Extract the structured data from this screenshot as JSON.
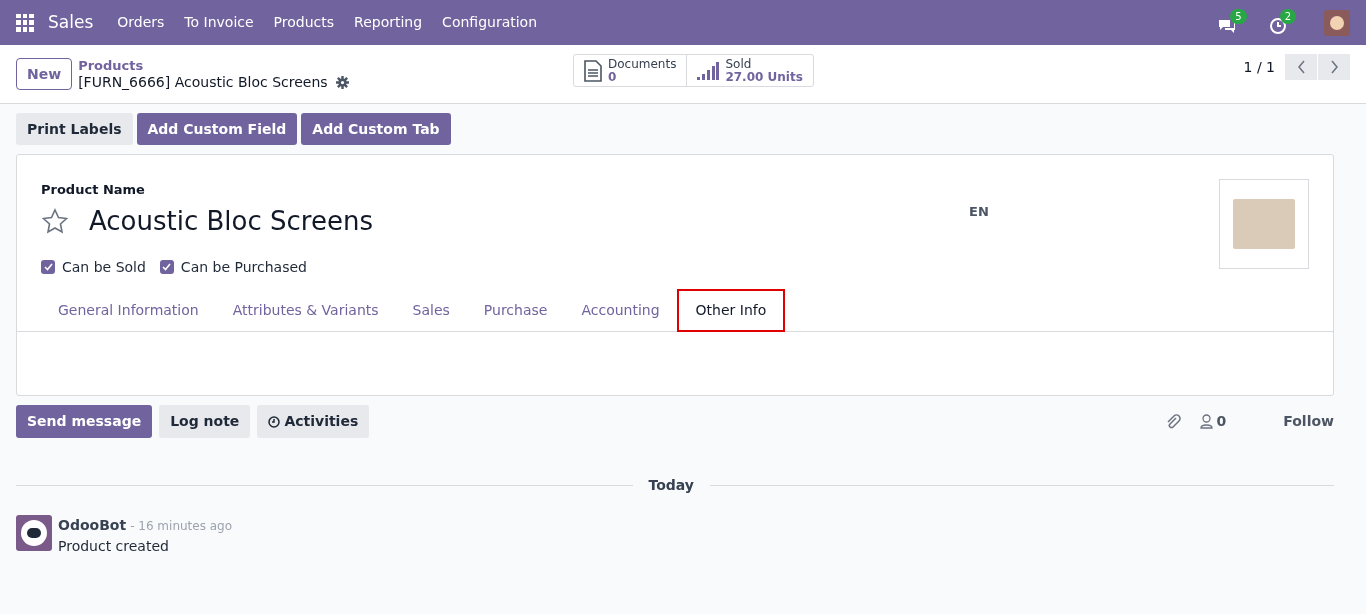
{
  "navbar": {
    "app": "Sales",
    "menu": [
      "Orders",
      "To Invoice",
      "Products",
      "Reporting",
      "Configuration"
    ],
    "messages_count": "5",
    "activities_count": "2"
  },
  "control_panel": {
    "new_button": "New",
    "breadcrumb": "Products",
    "record": "[FURN_6666] Acoustic Bloc Screens",
    "smart_buttons": [
      {
        "kind": "documents",
        "label": "Documents",
        "value": "0"
      },
      {
        "kind": "sold",
        "label": "Sold",
        "value": "27.00 Units"
      }
    ],
    "pager": "1 / 1"
  },
  "actions": [
    {
      "label": "Print Labels",
      "kind": "secondary"
    },
    {
      "label": "Add Custom Field",
      "kind": "primary"
    },
    {
      "label": "Add Custom Tab",
      "kind": "primary"
    }
  ],
  "form": {
    "name_label": "Product Name",
    "favorite": false,
    "name": "Acoustic Bloc Screens",
    "language": "EN",
    "checkboxes": [
      {
        "label": "Can be Sold",
        "checked": true
      },
      {
        "label": "Can be Purchased",
        "checked": true
      }
    ],
    "tabs": [
      {
        "label": "General Information",
        "selected": false
      },
      {
        "label": "Attributes & Variants",
        "selected": false
      },
      {
        "label": "Sales",
        "selected": false
      },
      {
        "label": "Purchase",
        "selected": false
      },
      {
        "label": "Accounting",
        "selected": false
      },
      {
        "label": "Other Info",
        "selected": true
      }
    ]
  },
  "chatter": {
    "buttons": [
      {
        "label": "Send message",
        "kind": "primary"
      },
      {
        "label": "Log note",
        "kind": "secondary"
      },
      {
        "label": "Activities",
        "kind": "activities"
      }
    ],
    "followers": "0",
    "follow": "Follow",
    "date_separator": "Today",
    "messages": [
      {
        "author": "OdooBot",
        "time": "- 16 minutes ago",
        "body": "Product created"
      }
    ]
  }
}
